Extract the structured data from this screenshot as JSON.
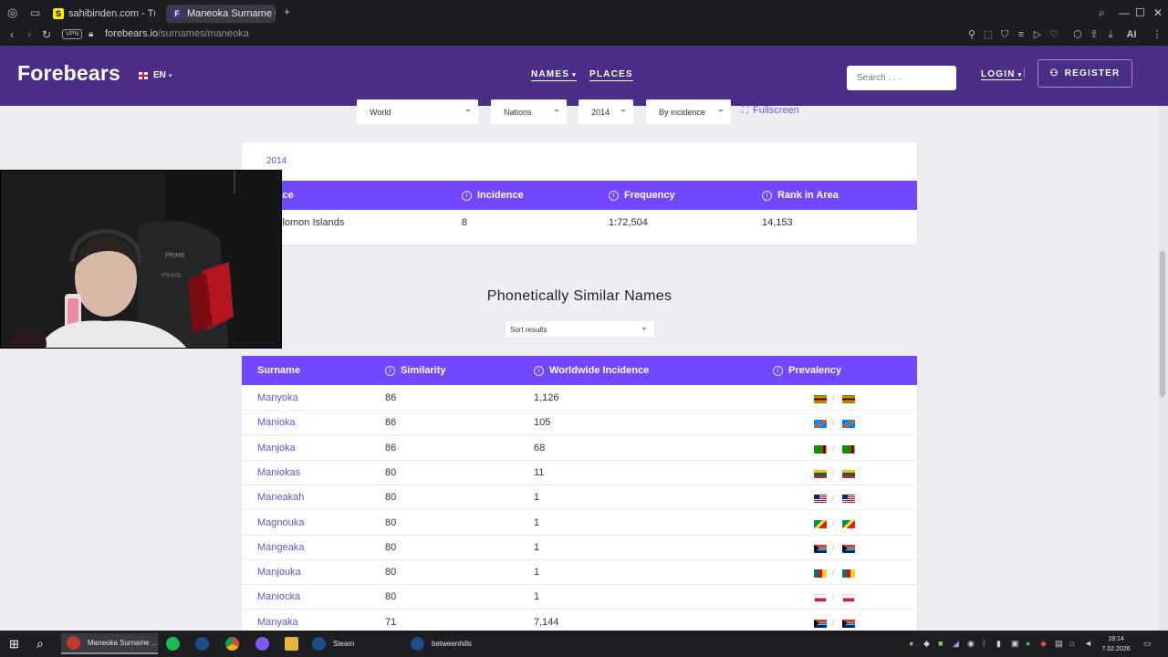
{
  "browser": {
    "tabs": [
      {
        "label": "sahibinden.com - Türkiye'",
        "favicon": "S"
      },
      {
        "label": "Maneoka Surname Origin",
        "favicon": "F"
      }
    ],
    "new_tab": "+",
    "vpn_badge": "VPN",
    "url_host": "forebears.io",
    "url_path": "/surnames/maneoka",
    "ai_label": "AI"
  },
  "site": {
    "logo": "Forebears",
    "lang": "EN",
    "nav": {
      "names": "NAMES",
      "places": "PLACES"
    },
    "search_placeholder": "Search . . .",
    "login": "LOGIN",
    "register": "REGISTER"
  },
  "filters": {
    "region": "World",
    "level": "Nations",
    "year": "2014",
    "mode": "By incidence",
    "fullscreen": "Fullscreen"
  },
  "area_table": {
    "year_label": "2014",
    "headers": [
      "Place",
      "Incidence",
      "Frequency",
      "Rank in Area"
    ],
    "rows": [
      {
        "place": "Solomon Islands",
        "incidence": "8",
        "frequency": "1:72,504",
        "rank": "14,153"
      }
    ]
  },
  "similar": {
    "title": "Phonetically Similar Names",
    "sort_label": "Sort results",
    "headers": [
      "Surname",
      "Similarity",
      "Worldwide Incidence",
      "Prevalency"
    ],
    "rows": [
      {
        "surname": "Manyoka",
        "similarity": "86",
        "incidence": "1,126",
        "flag": "zimbabwe"
      },
      {
        "surname": "Manioka",
        "similarity": "86",
        "incidence": "105",
        "flag": "dr-congo"
      },
      {
        "surname": "Manjoka",
        "similarity": "86",
        "incidence": "68",
        "flag": "zambia"
      },
      {
        "surname": "Maniokas",
        "similarity": "80",
        "incidence": "11",
        "flag": "lithuania"
      },
      {
        "surname": "Maneakah",
        "similarity": "80",
        "incidence": "1",
        "flag": "liberia"
      },
      {
        "surname": "Magnouka",
        "similarity": "80",
        "incidence": "1",
        "flag": "congo"
      },
      {
        "surname": "Mangeaka",
        "similarity": "80",
        "incidence": "1",
        "flag": "south-africa"
      },
      {
        "surname": "Manjouka",
        "similarity": "80",
        "incidence": "1",
        "flag": "cameroon"
      },
      {
        "surname": "Maniocka",
        "similarity": "80",
        "incidence": "1",
        "flag": "poland"
      },
      {
        "surname": "Manyaka",
        "similarity": "71",
        "incidence": "7,144",
        "flag": "south-africa"
      }
    ]
  },
  "webcam": {
    "chair_text": "PRIME"
  },
  "taskbar": {
    "apps": [
      {
        "label": "Maneoka Surname ...",
        "icon_color": "#c0392b"
      },
      {
        "label": "Steam",
        "icon_color": "#1b4f8a"
      },
      {
        "label": "betweenhills",
        "icon_color": "#1b4f8a"
      }
    ],
    "time": "19:14",
    "date": "7.02.2026"
  },
  "colors": {
    "header_bg": "#4a2d86",
    "table_header": "#7148ff",
    "link": "#6a4fd8",
    "page_bg": "#eeedf3"
  }
}
